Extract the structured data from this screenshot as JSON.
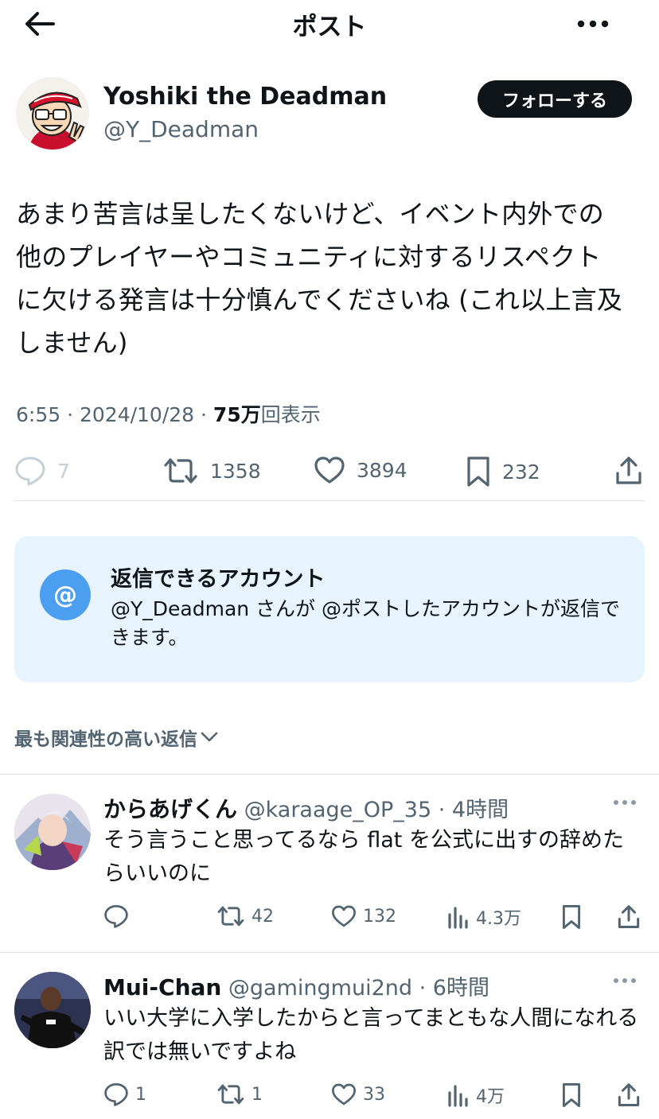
{
  "header": {
    "title": "ポスト"
  },
  "post": {
    "author_name": "Yoshiki the Deadman",
    "author_handle": "@Y_Deadman",
    "follow_label": "フォローする",
    "text": "あまり苦言は呈したくないけど、イベント内外での\n他のプレイヤーやコミュニティに対するリスペクト\nに欠ける発言は十分慎んでくださいね (これ以上言及\nしません)",
    "time": "6:55 · 2024/10/28 · ",
    "views": "75万",
    "views_suffix": "回表示",
    "replies": "7",
    "reposts": "1358",
    "likes": "3894",
    "bookmarks": "232"
  },
  "notice": {
    "icon": "@",
    "title": "返信できるアカウント",
    "body": "@Y_Deadman さんが @ポストしたアカウントが返信できます。"
  },
  "sort_label": "最も関連性の高い返信",
  "replies": [
    {
      "name": "からあげくん",
      "handle": "@karaage_OP_35",
      "sep": " · ",
      "time": "4時間",
      "text": "そう言うこと思ってるなら flat を公式に出すの辞めたらいいのに",
      "reply_count": "",
      "repost_count": "42",
      "like_count": "132",
      "view_count": "4.3万"
    },
    {
      "name": "Mui-Chan",
      "handle": "@gamingmui2nd",
      "sep": " · ",
      "time": "6時間",
      "text": "いい大学に入学したからと言ってまともな人間になれる訳では無いですよね",
      "reply_count": "1",
      "repost_count": "1",
      "like_count": "33",
      "view_count": "4万"
    }
  ],
  "colors": {
    "accent": "#1d9bf0",
    "text": "#0f1419",
    "muted": "#536471",
    "notice_bg": "#e8f4fd"
  },
  "icons": [
    "back-arrow-icon",
    "more-icon",
    "reply-icon",
    "repost-icon",
    "like-icon",
    "bookmark-icon",
    "share-icon",
    "views-icon",
    "chevron-down-icon"
  ]
}
